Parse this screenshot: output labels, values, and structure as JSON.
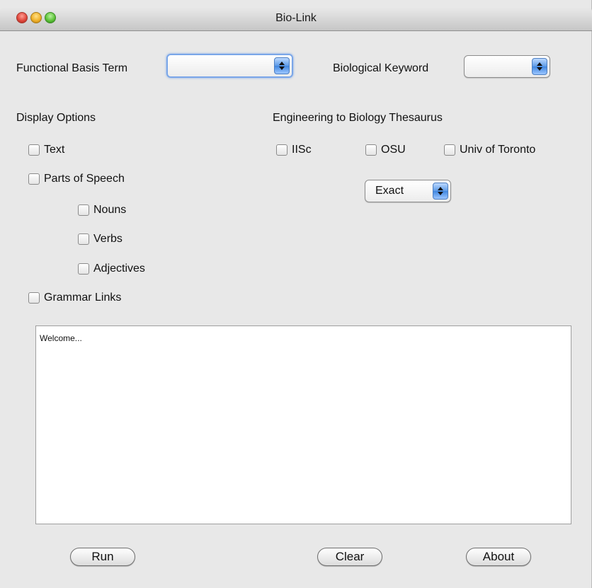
{
  "window": {
    "title": "Bio-Link"
  },
  "inputs": {
    "functional_basis_label": "Functional Basis Term",
    "functional_basis_value": "",
    "bio_keyword_label": "Biological Keyword",
    "bio_keyword_value": ""
  },
  "display_options": {
    "title": "Display Options",
    "text": "Text",
    "parts_of_speech": "Parts of Speech",
    "nouns": "Nouns",
    "verbs": "Verbs",
    "adjectives": "Adjectives",
    "grammar_links": "Grammar Links"
  },
  "thesaurus": {
    "title": "Engineering to Biology Thesaurus",
    "iisc": "IISc",
    "osu": "OSU",
    "toronto": "Univ of Toronto",
    "match_mode": "Exact"
  },
  "output": {
    "text": "Welcome..."
  },
  "buttons": {
    "run": "Run",
    "clear": "Clear",
    "about": "About"
  }
}
